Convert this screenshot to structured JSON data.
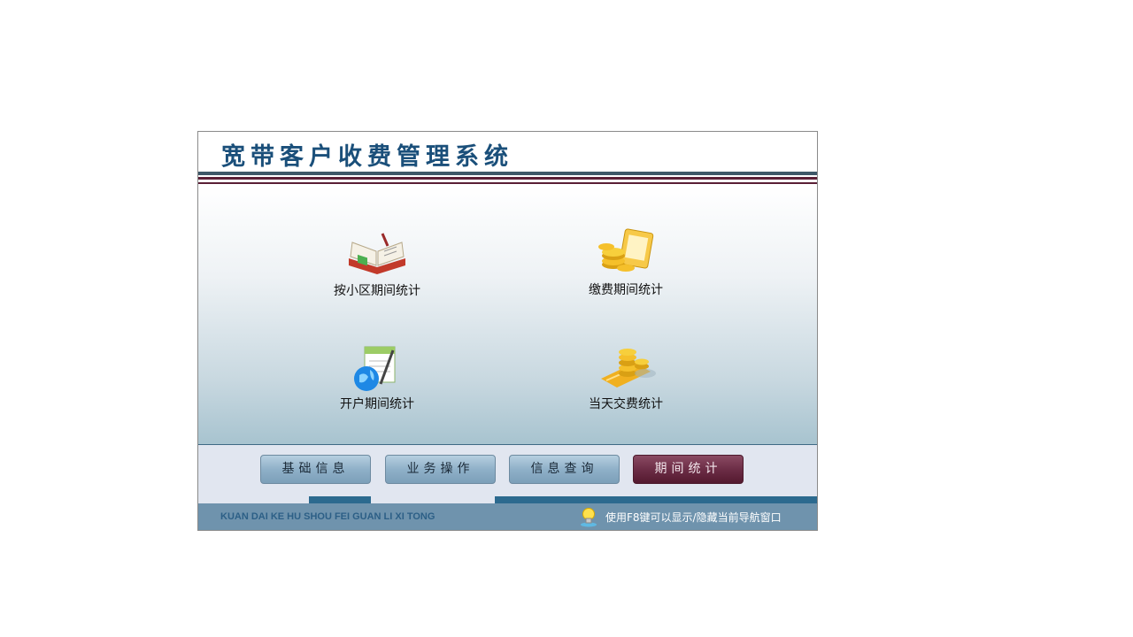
{
  "app": {
    "title": "宽带客户收费管理系统"
  },
  "menu": {
    "items": [
      {
        "label": "按小区期间统计",
        "icon": "open-book-icon"
      },
      {
        "label": "缴费期间统计",
        "icon": "coins-document-icon"
      },
      {
        "label": "开户期间统计",
        "icon": "globe-notepad-icon"
      },
      {
        "label": "当天交费统计",
        "icon": "coin-stack-icon"
      }
    ]
  },
  "nav": {
    "buttons": [
      {
        "label": "基础信息",
        "active": false
      },
      {
        "label": "业务操作",
        "active": false
      },
      {
        "label": "信息查询",
        "active": false
      },
      {
        "label": "期间统计",
        "active": true
      }
    ]
  },
  "footer": {
    "pinyin": "KUAN DAI KE HU SHOU FEI GUAN LI XI TONG",
    "hint": "使用F8键可以显示/隐藏当前导航窗口",
    "hint_icon": "lightbulb-icon"
  },
  "colors": {
    "title": "#1a4f7a",
    "active_nav": "#6c2d46",
    "nav_button": "#8fb0c8",
    "footer": "#6f93ad",
    "accent_band": "#2c6a8f"
  }
}
